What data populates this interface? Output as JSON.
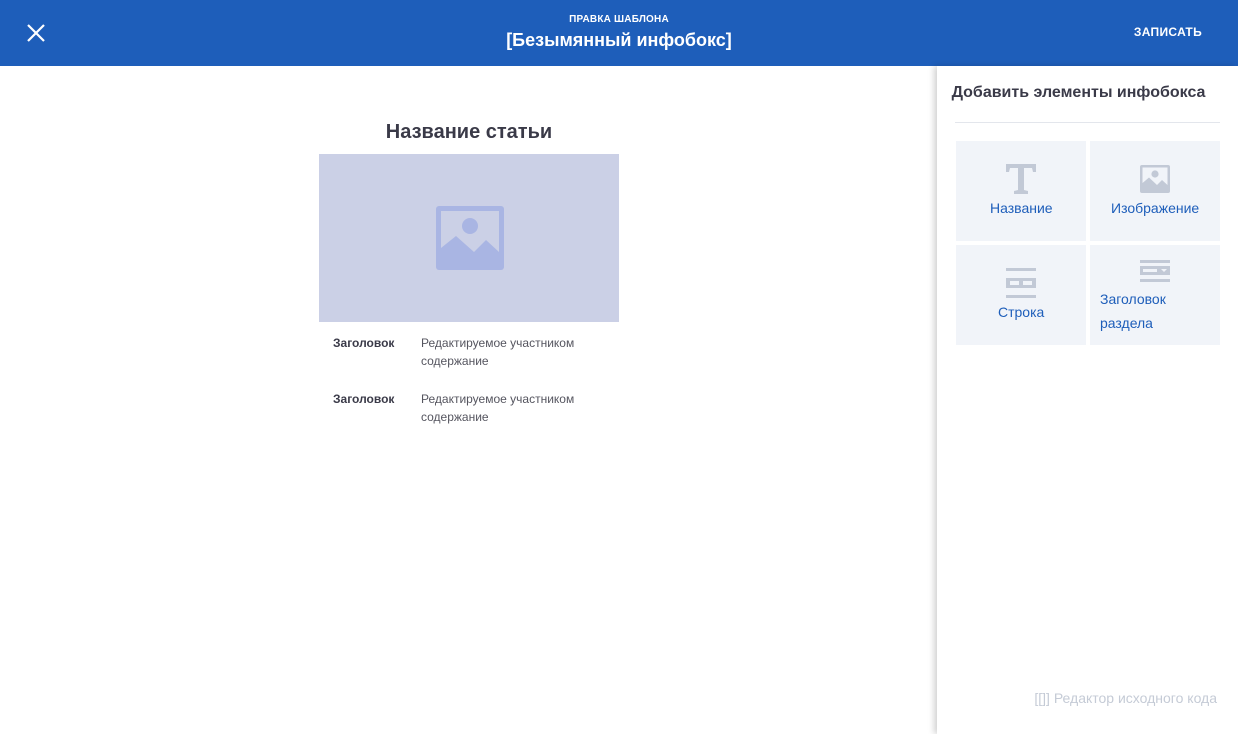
{
  "header": {
    "subtitle": "ПРАВКА ШАБЛОНА",
    "title": "[Безымянный инфобокс]",
    "save_label": "ЗАПИСАТЬ",
    "background": "#1e5eba",
    "close_icon": "close-icon"
  },
  "infobox": {
    "title": "Название статьи",
    "image_icon": "image-placeholder-icon",
    "rows": [
      {
        "label": "Заголовок",
        "value": "Редактируемое участником содержание"
      },
      {
        "label": "Заголовок",
        "value": "Редактируемое участником содержание"
      }
    ]
  },
  "panel": {
    "title": "Добавить элементы инфобокса",
    "elements": [
      {
        "label": "Название",
        "icon": "text-icon"
      },
      {
        "label": "Изображение",
        "icon": "image-icon"
      },
      {
        "label": "Строка",
        "icon": "row-icon"
      },
      {
        "label": "Заголовок раздела",
        "icon": "section-header-icon"
      }
    ],
    "source_editor_label": "[[]] Редактор исходного кода"
  },
  "colors": {
    "accent": "#1e5eba",
    "tile_background": "#f1f4f9",
    "image_placeholder": "#cbd0e6",
    "icon_gray": "#c2c9d6"
  }
}
